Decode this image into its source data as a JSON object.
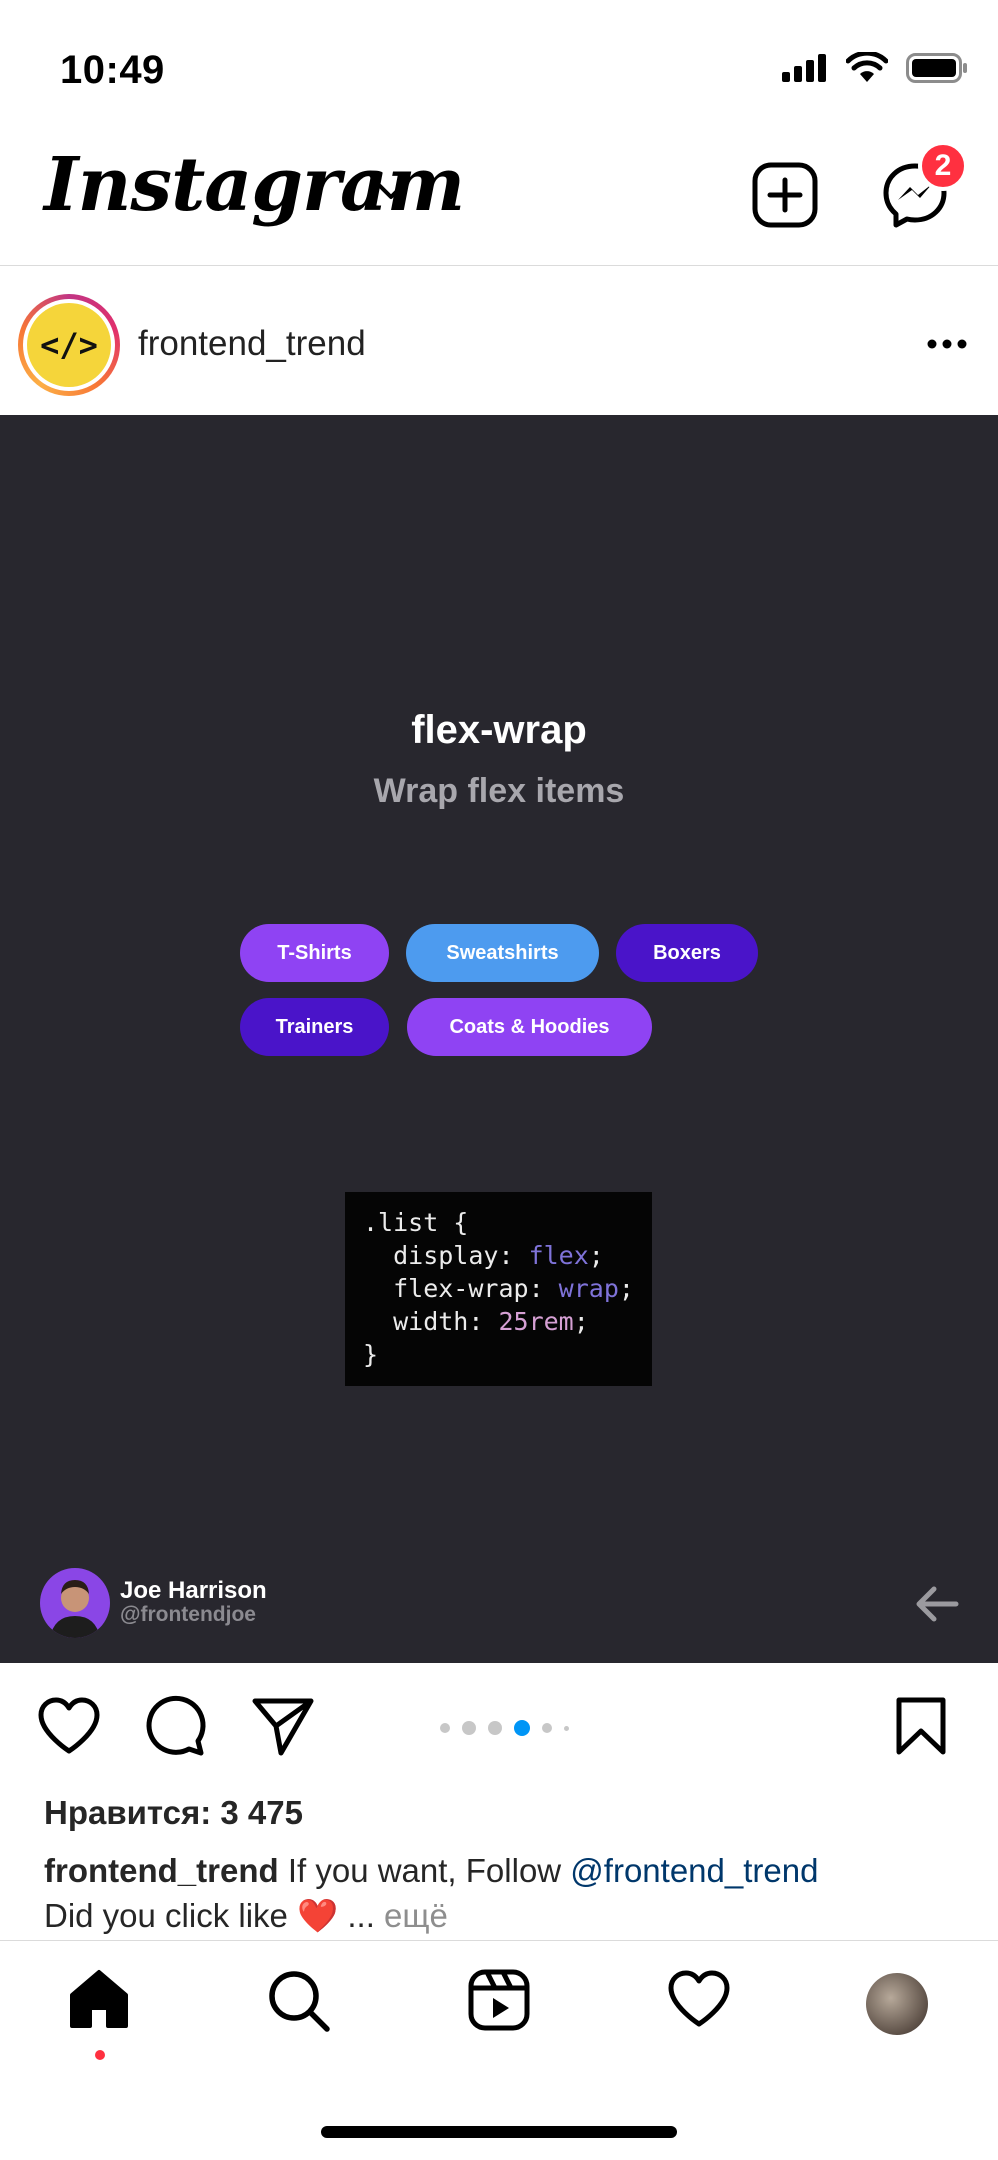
{
  "status_bar": {
    "time": "10:49"
  },
  "header": {
    "logo": "Instagram",
    "messenger_badge": "2"
  },
  "post": {
    "username": "frontend_trend",
    "avatar_text": "</>",
    "media": {
      "title": "flex-wrap",
      "subtitle": "Wrap flex items",
      "chips": [
        {
          "label": "T-Shirts",
          "color": "#8f43f3"
        },
        {
          "label": "Sweatshirts",
          "color": "#4d9bef"
        },
        {
          "label": "Boxers",
          "color": "#4a14c9"
        },
        {
          "label": "Trainers",
          "color": "#4a14c9"
        },
        {
          "label": "Coats & Hoodies",
          "color": "#8f43f3"
        }
      ],
      "code": {
        "line1": ".list {",
        "line2_prop": "  display: ",
        "line2_val": "flex",
        "line3_prop": "  flex-wrap: ",
        "line3_val": "wrap",
        "line4_prop": "  width: ",
        "line4_val": "25rem",
        "line5": "}"
      },
      "author": {
        "name": "Joe Harrison",
        "handle": "@frontendjoe"
      }
    },
    "carousel": {
      "total": 6,
      "active_index": 3
    },
    "likes": "Нравится: 3 475",
    "caption": {
      "username": "frontend_trend",
      "text": "If you want, Follow",
      "mention": "@frontend_trend",
      "line2": "Did you click like",
      "emoji": "❤️",
      "ellipsis": "...",
      "more": "ещё"
    }
  }
}
